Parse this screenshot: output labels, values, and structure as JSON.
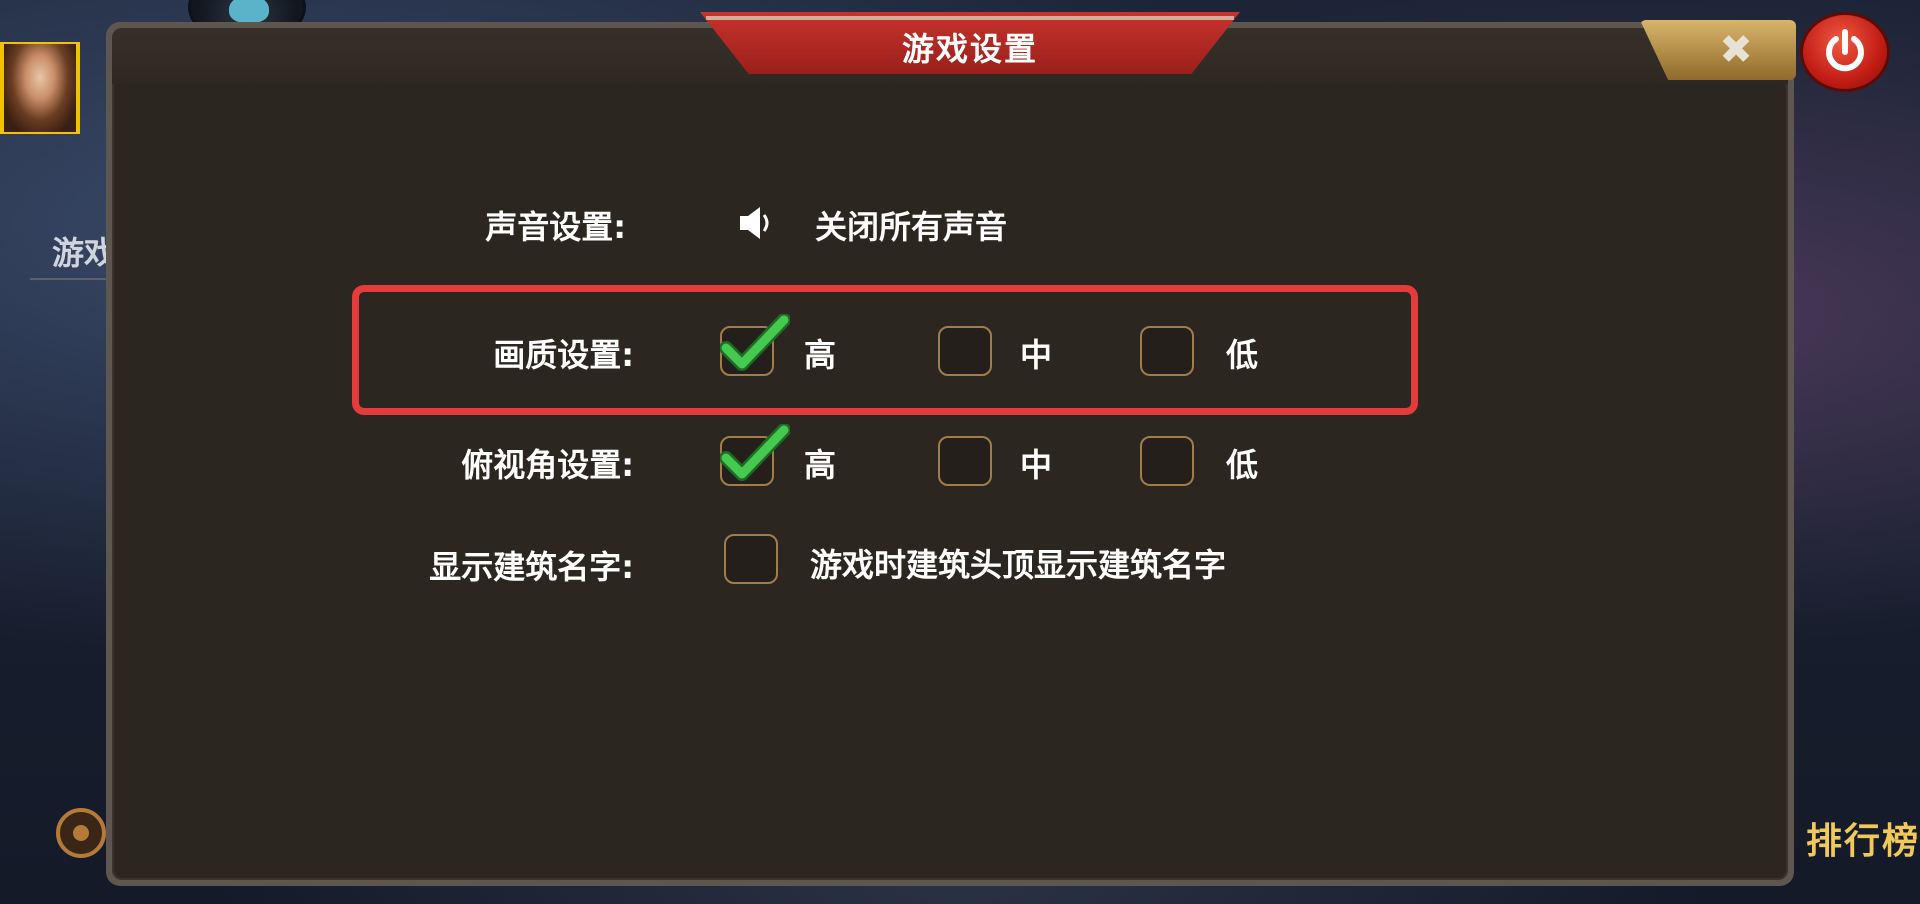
{
  "dialog": {
    "title": "游戏设置",
    "close_icon": "close-icon",
    "power_icon": "power-icon"
  },
  "background": {
    "side_text": "游戏",
    "rank_text": "排行榜"
  },
  "settings": {
    "sound": {
      "label": "声音设置:",
      "option_text": "关闭所有声音",
      "icon": "speaker-icon"
    },
    "graphics": {
      "label": "画质设置:",
      "options": [
        {
          "text": "高",
          "checked": true
        },
        {
          "text": "中",
          "checked": false
        },
        {
          "text": "低",
          "checked": false
        }
      ]
    },
    "view_angle": {
      "label": "俯视角设置:",
      "options": [
        {
          "text": "高",
          "checked": true
        },
        {
          "text": "中",
          "checked": false
        },
        {
          "text": "低",
          "checked": false
        }
      ]
    },
    "building_names": {
      "label": "显示建筑名字:",
      "checked": false,
      "description": "游戏时建筑头顶显示建筑名字"
    }
  },
  "colors": {
    "highlight": "#e43c3a",
    "check_green": "#3fc04a",
    "ribbon_red": "#b82822",
    "panel_bg": "#2c2621"
  }
}
